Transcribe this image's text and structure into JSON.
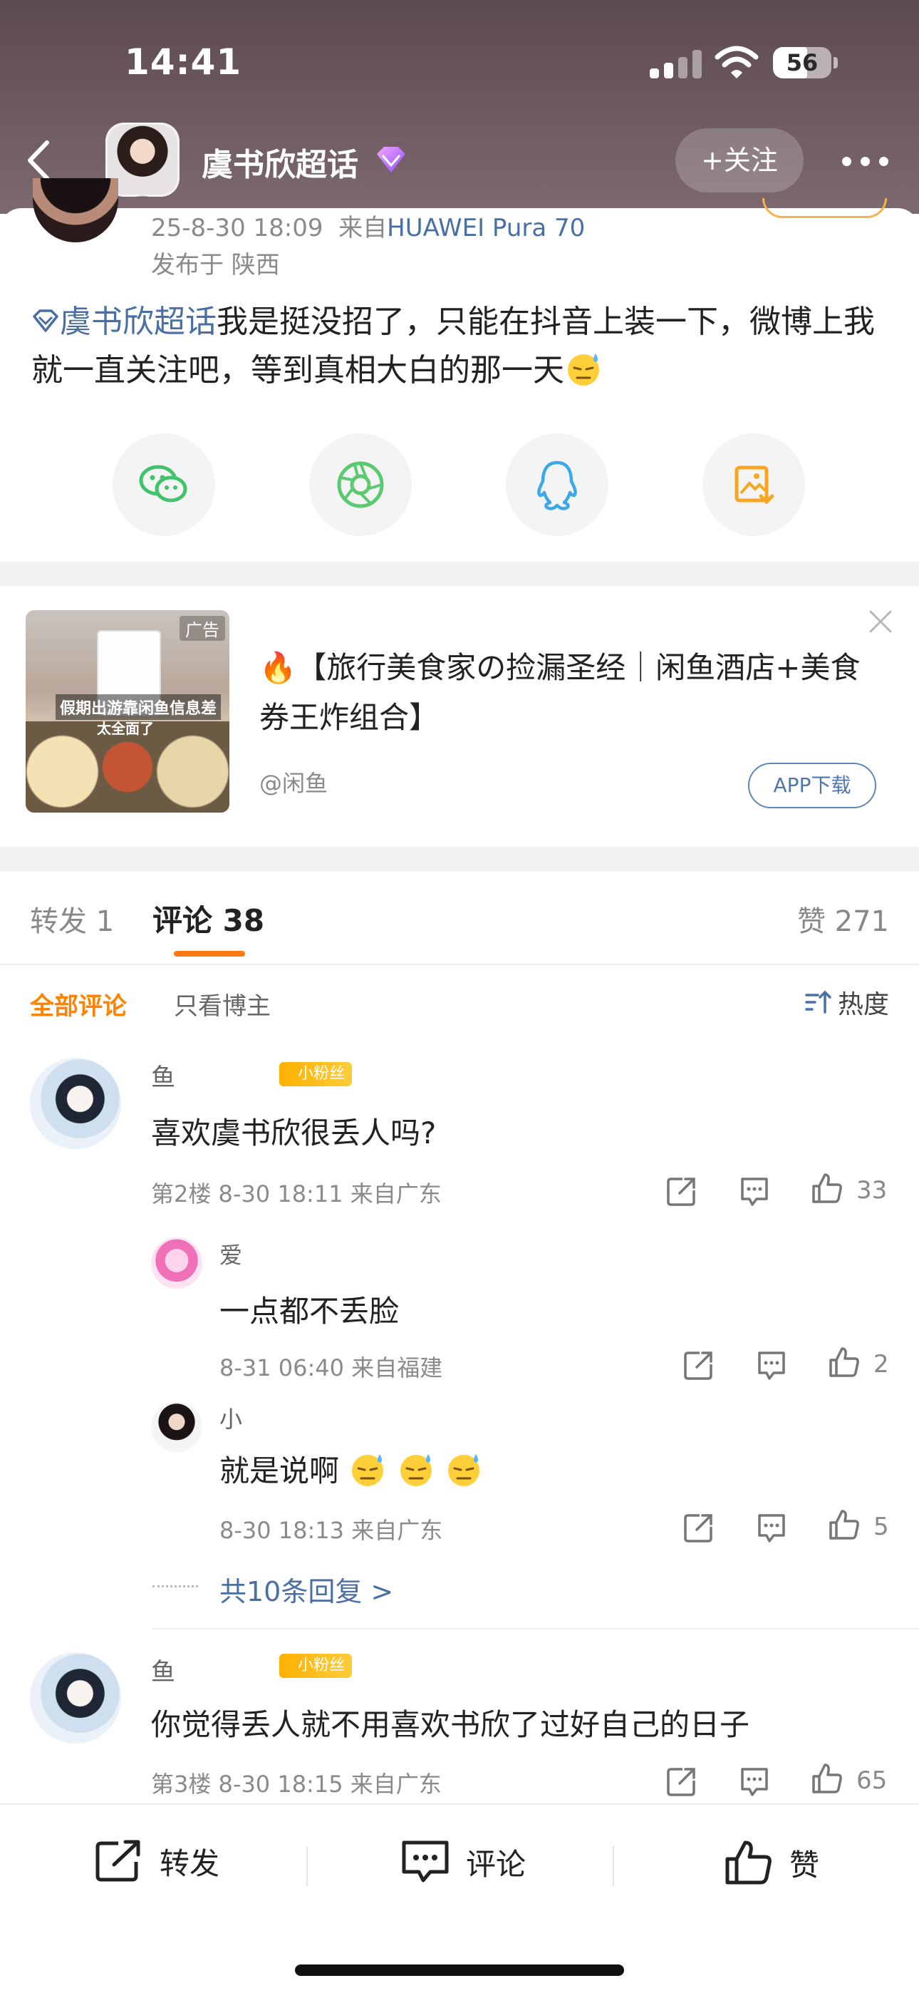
{
  "status_bar": {
    "time": "14:41",
    "battery": "56"
  },
  "header": {
    "title": "虞书欣超话",
    "follow_label": "+关注"
  },
  "post": {
    "time": "25-8-30 18:09",
    "device_prefix": "来自",
    "device": "HUAWEI Pura 70",
    "location": "发布于 陕西",
    "topic": "虞书欣超话",
    "text": "我是挺没招了，只能在抖音上装一下，微博上我就一直关注吧，等到真相大白的那一天"
  },
  "share_icons": [
    "wechat-icon",
    "moments-icon",
    "qq-icon",
    "save-image-icon"
  ],
  "ad": {
    "badge": "广告",
    "image_caption": "假期出游靠闲鱼信息差",
    "image_caption2": "太全面了",
    "title": "🔥【旅行美食家の捡漏圣经｜闲鱼酒店+美食券王炸组合】",
    "source": "@闲鱼",
    "button": "APP下载"
  },
  "tabs": {
    "repost": "转发 1",
    "comments": "评论 38",
    "likes": "赞 271"
  },
  "filters": {
    "all": "全部评论",
    "author_only": "只看博主",
    "sort": "热度"
  },
  "comments": [
    {
      "name": "鱼",
      "badge": "小粉丝",
      "text": "喜欢虞书欣很丢人吗?",
      "meta": "第2楼 8-30 18:11 来自广东",
      "likes": "33",
      "replies": [
        {
          "name": "爱",
          "text": "一点都不丢脸",
          "meta": "8-31 06:40 来自福建",
          "likes": "2"
        },
        {
          "name": "小",
          "text": "就是说啊",
          "meta": "8-30 18:13 来自广东",
          "likes": "5"
        }
      ],
      "more_replies": "共10条回复 >"
    },
    {
      "name": "鱼",
      "badge": "小粉丝",
      "text": "你觉得丢人就不用喜欢书欣了过好自己的日子",
      "meta": "第3楼 8-30 18:15 来自广东",
      "likes": "65"
    }
  ],
  "bottom_bar": {
    "repost": "转发",
    "comment": "评论",
    "like": "赞"
  }
}
